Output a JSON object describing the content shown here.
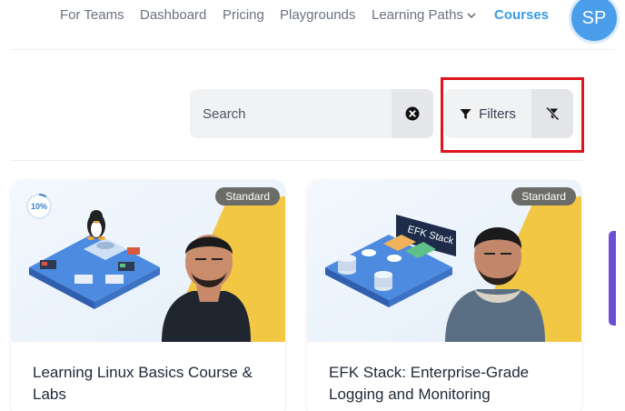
{
  "nav": {
    "items": [
      {
        "label": "For Teams"
      },
      {
        "label": "Dashboard"
      },
      {
        "label": "Pricing"
      },
      {
        "label": "Playgrounds"
      },
      {
        "label": "Learning Paths"
      },
      {
        "label": "Courses"
      }
    ],
    "avatar_initials": "SP",
    "accent_color": "#3b9be0"
  },
  "search": {
    "placeholder": "Search",
    "value": "",
    "clear_icon": "close-circle-icon"
  },
  "filters": {
    "label": "Filters",
    "icon": "filter-icon",
    "clear_icon": "filter-off-icon",
    "highlight_color": "#e0141c"
  },
  "courses": [
    {
      "badge": "Standard",
      "progress": "10%",
      "progress_value": 0.1,
      "title": "Learning Linux Basics Course & Labs"
    },
    {
      "badge": "Standard",
      "banner_text": "EFK Stack",
      "title": "EFK Stack: Enterprise-Grade Logging and Monitoring"
    }
  ]
}
